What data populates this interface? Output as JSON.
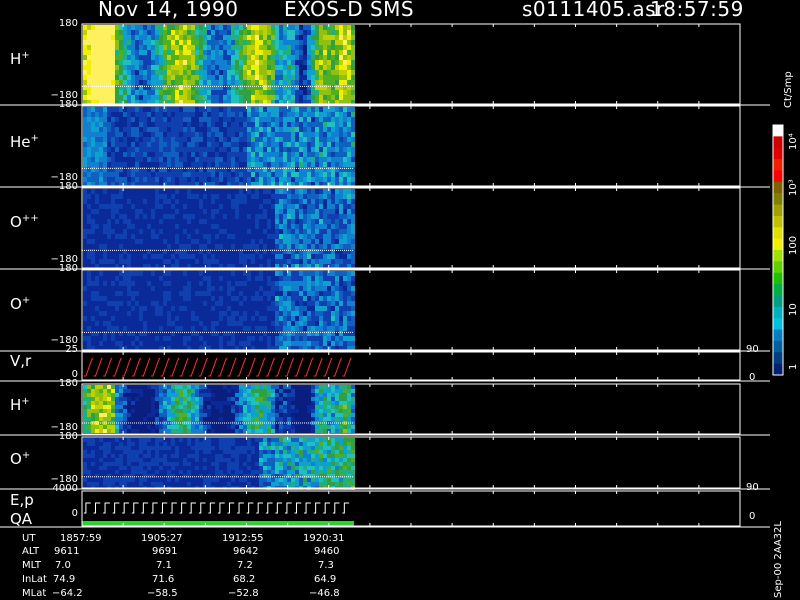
{
  "header": {
    "date": "Nov 14, 1990",
    "instrument": "EXOS-D SMS",
    "file": "s0111405.asr",
    "time": "18:57:59"
  },
  "panels": [
    {
      "id": "h-plus",
      "species": "H",
      "charge": "+",
      "ymax": "180",
      "ymin": "−180"
    },
    {
      "id": "he-plus",
      "species": "He",
      "charge": "+",
      "ymax": "180",
      "ymin": "−180"
    },
    {
      "id": "o-pp",
      "species": "O",
      "charge": "++",
      "ymax": "180",
      "ymin": "−180"
    },
    {
      "id": "o-plus",
      "species": "O",
      "charge": "+",
      "ymax": "180",
      "ymin": "−180"
    },
    {
      "id": "vr",
      "label": "V,r",
      "ymax": "25",
      "ymin": "0",
      "rmax": "90",
      "rmin": "0"
    },
    {
      "id": "h-plus-2",
      "species": "H",
      "charge": "+",
      "ymax": "180",
      "ymin": "−180"
    },
    {
      "id": "o-plus-2",
      "species": "O",
      "charge": "+",
      "ymax": "180",
      "ymin": "−180",
      "ymin_display": "−180"
    },
    {
      "id": "ep-qa",
      "label": "E,p",
      "label2": "QA",
      "ymax": "4000",
      "ymin": "0",
      "rmax": "90",
      "rmin": "0"
    }
  ],
  "colorbar": {
    "unit": "Ct/Smp",
    "ticks": [
      "10⁴",
      "10³",
      "100",
      "10",
      "1"
    ],
    "colors": [
      "#ffffff",
      "#d00000",
      "#e00000",
      "#f02000",
      "#ff0000",
      "#806000",
      "#808000",
      "#a0a000",
      "#c0c000",
      "#e0e000",
      "#f0f000",
      "#a0e000",
      "#60d000",
      "#20c000",
      "#00b040",
      "#00a080",
      "#00b0c0",
      "#00c0e0",
      "#0080c0",
      "#0060a0",
      "#004080",
      "#002070"
    ]
  },
  "footer": {
    "rows": [
      {
        "label": "UT",
        "values": [
          "1857:59",
          "1905:27",
          "1912:55",
          "1920:31"
        ]
      },
      {
        "label": "ALT",
        "values": [
          "9611",
          "9691",
          "9642",
          "9460"
        ]
      },
      {
        "label": "MLT",
        "values": [
          "7.0",
          "7.1",
          "7.2",
          "7.3"
        ]
      },
      {
        "label": "InLat",
        "values": [
          "74.9",
          "71.6",
          "68.2",
          "64.9"
        ]
      },
      {
        "label": "MLat",
        "values": [
          "−64.2",
          "−58.5",
          "−52.8",
          "−46.8"
        ]
      }
    ],
    "version": "Sep-00  2AA32L"
  },
  "chart_data": {
    "type": "heatmap",
    "x_ticks_ut": [
      "1857:59",
      "1905:27",
      "1912:55",
      "1920:31"
    ],
    "panels": [
      {
        "name": "H+",
        "y_range": [
          -180,
          180
        ]
      },
      {
        "name": "He+",
        "y_range": [
          -180,
          180
        ]
      },
      {
        "name": "O++",
        "y_range": [
          -180,
          180
        ]
      },
      {
        "name": "O+",
        "y_range": [
          -180,
          180
        ]
      },
      {
        "name": "V,r",
        "y_range": [
          0,
          25
        ],
        "right_range": [
          0,
          90
        ]
      },
      {
        "name": "H+",
        "y_range": [
          -180,
          180
        ]
      },
      {
        "name": "O+",
        "y_range": [
          -180,
          180
        ]
      },
      {
        "name": "E,p / QA",
        "y_range": [
          0,
          4000
        ],
        "right_range": [
          0,
          90
        ]
      }
    ],
    "color_scale": {
      "unit": "Ct/Smp",
      "min": 1,
      "max": 10000,
      "log": true
    }
  }
}
